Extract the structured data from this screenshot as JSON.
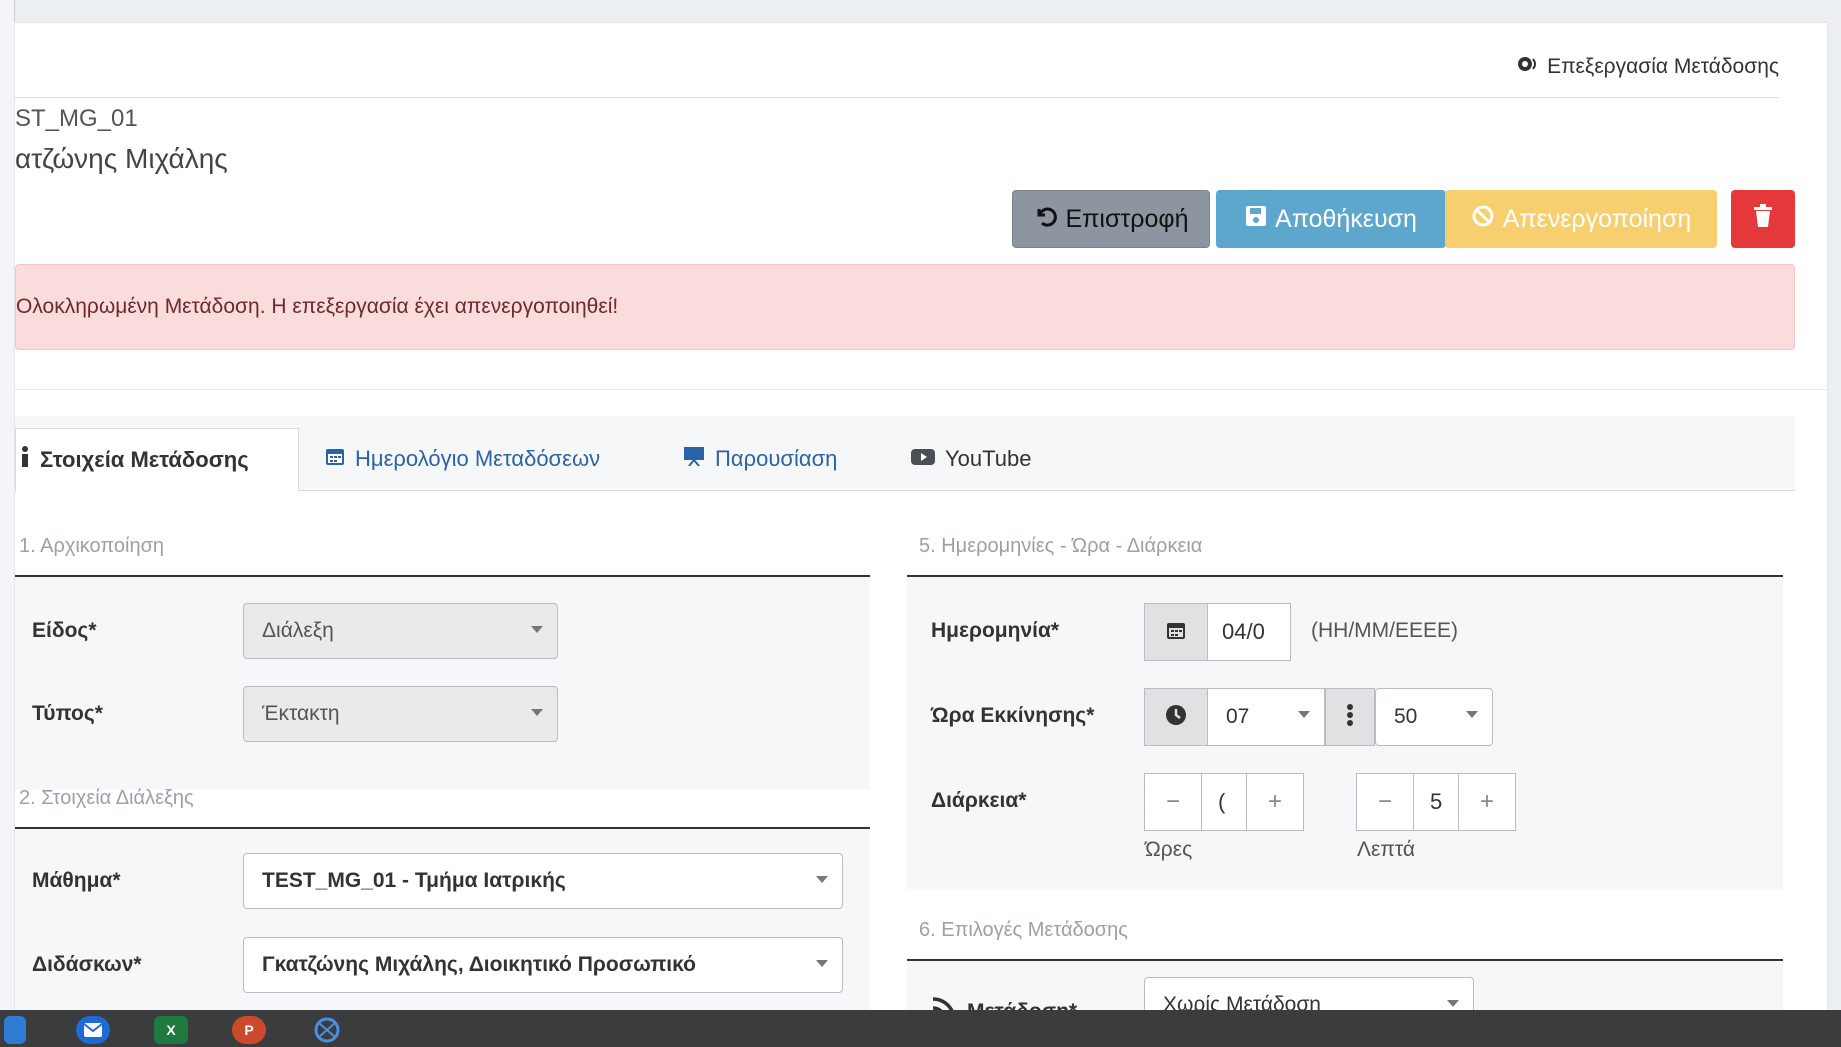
{
  "header": {
    "page_label": "Επεξεργασία Μετάδοσης",
    "course_code": "ST_MG_01",
    "person": "ατζώνης Μιχάλης"
  },
  "toolbar": {
    "back_label": "Επιστροφή",
    "save_label": "Αποθήκευση",
    "disable_label": "Απενεργοποίηση"
  },
  "alert": {
    "text": "Ολοκληρωμένη Μετάδοση. Η επεξεργασία έχει απενεργοποιηθεί!"
  },
  "tabs": [
    {
      "label": "Στοιχεία Μετάδοσης"
    },
    {
      "label": "Ημερολόγιο Μεταδόσεων"
    },
    {
      "label": "Παρουσίαση"
    },
    {
      "label": "YouTube"
    }
  ],
  "sections": {
    "init": {
      "title": "1. Αρχικοποίηση"
    },
    "lecture": {
      "title": "2. Στοιχεία Διάλεξης"
    },
    "dates": {
      "title": "5. Ημερομηνίες - Ώρα - Διάρκεια"
    },
    "options": {
      "title": "6. Επιλογές Μετάδοσης"
    }
  },
  "form": {
    "kind_label": "Είδος*",
    "kind_value": "Διάλεξη",
    "type_label": "Τύπος*",
    "type_value": "Έκτακτη",
    "course_label": "Μάθημα*",
    "course_value": "TEST_MG_01 - Τμήμα Ιατρικής",
    "teacher_label": "Διδάσκων*",
    "teacher_value": "Γκατζώνης Μιχάλης, Διοικητικό Προσωπικό",
    "date_label": "Ημερομηνία*",
    "date_value": "04/0",
    "date_hint": "(ΗΗ/ΜΜ/ΕΕΕΕ)",
    "start_label": "Ώρα Εκκίνησης*",
    "hour_value": "07",
    "minute_value": "50",
    "duration_label": "Διάρκεια*",
    "hours_value": "(",
    "minutes_value": "5",
    "hours_caption": "Ώρες",
    "minutes_caption": "Λεπτά",
    "broadcast_label": "Μετάδοση*",
    "broadcast_value": "Χωρίς Μετάδοση"
  },
  "colors": {
    "save": "#5da7cf",
    "disable": "#f7cf6e",
    "delete": "#e5383b",
    "alert_bg": "#fadcdc",
    "annotation_arrow": "#f25b6a"
  }
}
